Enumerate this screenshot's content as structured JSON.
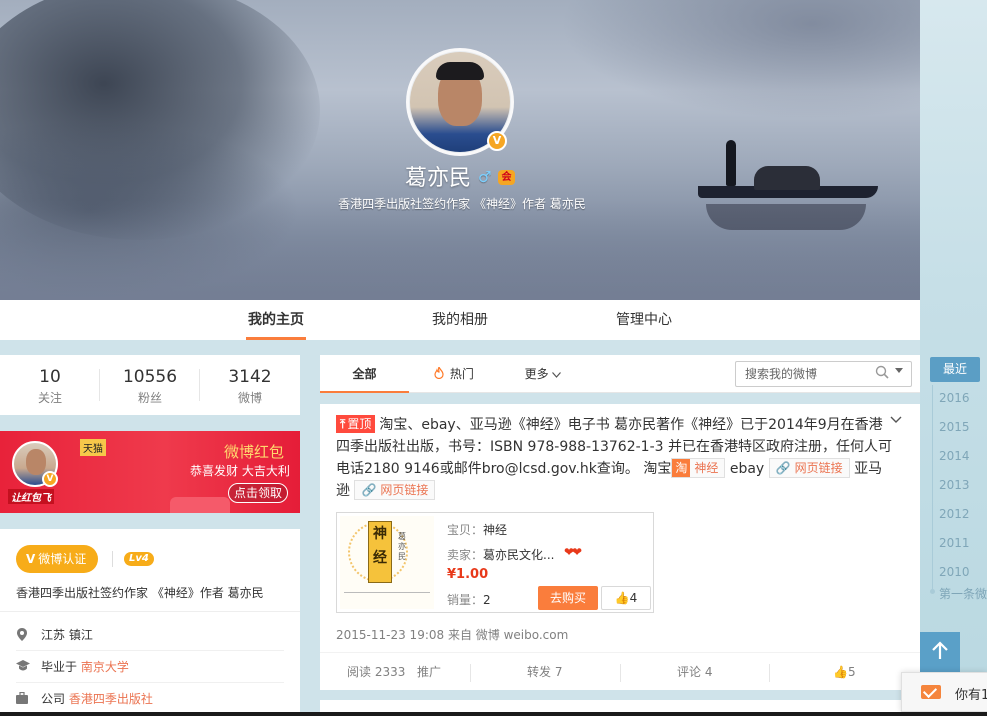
{
  "profile": {
    "name": "葛亦民",
    "gender_symbol": "♂",
    "verified_symbol": "V",
    "member_icon_text": "会",
    "description": "香港四季出版社签约作家 《神经》作者 葛亦民"
  },
  "nav": {
    "tabs": [
      {
        "label": "我的主页",
        "active": true
      },
      {
        "label": "我的相册",
        "active": false
      },
      {
        "label": "管理中心",
        "active": false
      }
    ]
  },
  "stats": [
    {
      "value": "10",
      "label": "关注"
    },
    {
      "value": "10556",
      "label": "粉丝"
    },
    {
      "value": "3142",
      "label": "微博"
    }
  ],
  "redpack": {
    "avatar_tag": "让红包飞",
    "tmall": "天猫",
    "title": "微博红包",
    "subtitle": "恭喜发财 大吉大利",
    "button": "点击领取"
  },
  "info": {
    "verify_label": "微博认证",
    "verify_icon": "V",
    "level": "Lv4",
    "description": "香港四季出版社签约作家 《神经》作者 葛亦民",
    "location": "江苏 镇江",
    "school_prefix": "毕业于",
    "school": "南京大学",
    "company_prefix": "公司",
    "company": "香港四季出版社"
  },
  "feed_tabs": {
    "all": "全部",
    "hot": "热门",
    "hot_icon": "fire-icon",
    "more": "更多",
    "search_placeholder": "搜索我的微博"
  },
  "post": {
    "pin_label": "置顶",
    "text_main": "淘宝、ebay、亚马逊《神经》电子书 葛亦民著作《神经》已于2014年9月在香港四季出版社出版，书号：ISBN 978-988-13762-1-3 并已在香港特区政府注册，任何人可电话2180 9146或邮件bro@lcsd.gov.hk查询。 淘宝",
    "taobao_icon": "淘",
    "taobao_tag": "神经",
    "ebay": "ebay",
    "link_label_1": "网页链接",
    "amazon": "亚马逊",
    "link_label_2": "网页链接",
    "card": {
      "cover_title": "神经",
      "cover_author": "葛亦民",
      "item_key": "宝贝：",
      "item_value": "神经",
      "seller_key": "卖家：",
      "seller_value": "葛亦民文化...",
      "price": "¥1.00",
      "sales_key": "销量：",
      "sales_value": "2",
      "buy_button": "去购买",
      "like_count": "4"
    },
    "meta": "2015-11-23 19:08 来自 微博 weibo.com",
    "actions": {
      "read": "阅读 2333",
      "promote": "推广",
      "forward": "转发 7",
      "comment": "评论 4",
      "like": "5"
    }
  },
  "timeline": {
    "recent": "最近",
    "years": [
      "2016",
      "2015",
      "2014",
      "2013",
      "2012",
      "2011",
      "2010"
    ],
    "first": "第一条微博"
  },
  "message_bar": {
    "text": "你有1"
  },
  "colors": {
    "accent": "#fa7d3c",
    "link": "#eb7350",
    "gold": "#f7ac19"
  }
}
